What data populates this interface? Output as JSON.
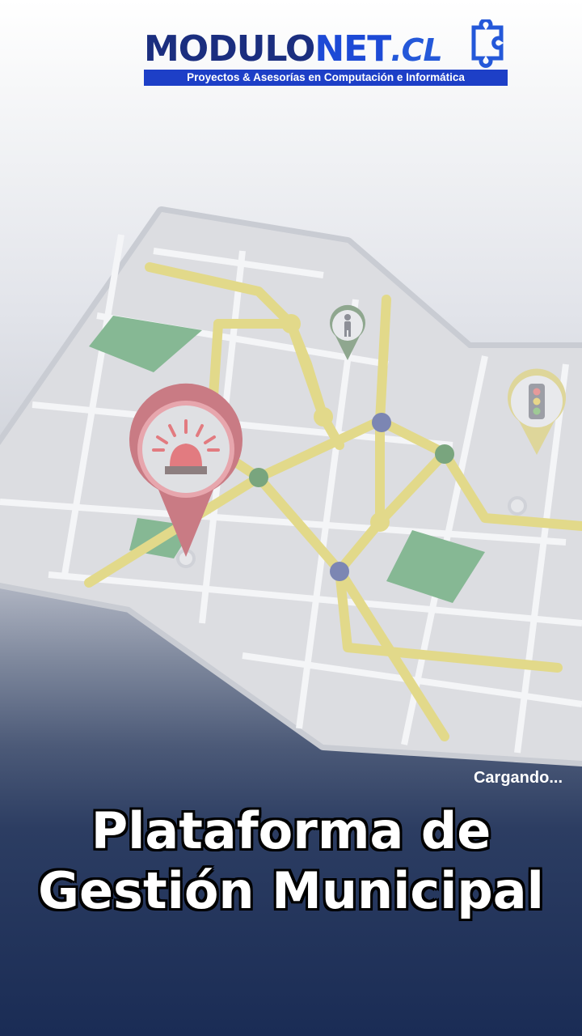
{
  "logo": {
    "word_part1": "MODULO",
    "word_part2": "NET",
    "word_part3": ".CL",
    "tagline": "Proyectos & Asesorías en Computación e Informática"
  },
  "status": {
    "loading_text": "Cargando..."
  },
  "title": {
    "line1": "Plataforma de",
    "line2": "Gestión Municipal"
  },
  "colors": {
    "brand_dark": "#1b2e7f",
    "brand_blue": "#1d4ad6",
    "background_bottom": "#1a2c55"
  },
  "map_icons": [
    "alarm-siren-icon",
    "pedestrian-icon",
    "traffic-light-icon"
  ]
}
